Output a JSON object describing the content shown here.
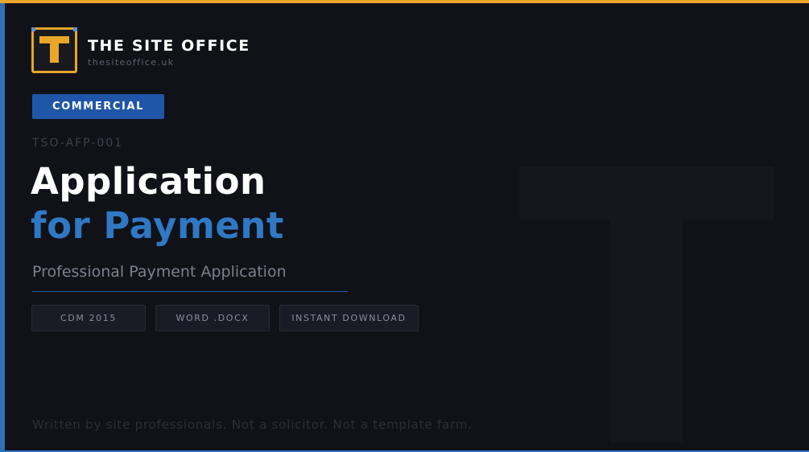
{
  "brand": {
    "name": "THE SITE OFFICE",
    "url": "thesiteoffice.uk",
    "logo_letter": "T"
  },
  "badge": {
    "label": "COMMERCIAL"
  },
  "document": {
    "code": "TSO-AFP-001",
    "title_line1": "Application",
    "title_line2": "for Payment",
    "subtitle": "Professional Payment Application"
  },
  "tags": [
    {
      "label": "CDM 2015"
    },
    {
      "label": "WORD .DOCX"
    },
    {
      "label": "INSTANT DOWNLOAD"
    }
  ],
  "footer": {
    "note": "Written by site professionals. Not a solicitor. Not a template farm."
  },
  "colors": {
    "background": "#101218",
    "accent_orange": "#e8a62a",
    "accent_blue": "#2f6fb8",
    "title_blue": "#2f78c4",
    "badge_blue": "#1f56a8"
  },
  "icons": {
    "logo": "brand-t-logo-icon",
    "watermark": "t-watermark-icon"
  }
}
